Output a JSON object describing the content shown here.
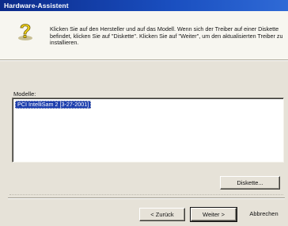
{
  "window": {
    "title": "Hardware-Assistent"
  },
  "header": {
    "icon": "question-mark-icon",
    "instructions": "Klicken Sie auf den Hersteller und auf das Modell. Wenn sich der Treiber auf einer Diskette befindet, klicken Sie auf \"Diskette\". Klicken Sie auf \"Weiter\", um den aktualisierten Treiber zu installieren."
  },
  "models": {
    "label": "Modelle:",
    "items": [
      {
        "label": "PCI IntelliSam 2 [3-27-2001]",
        "selected": true
      }
    ]
  },
  "buttons": {
    "diskette": "Diskette...",
    "back": "< Zurück",
    "next": "Weiter >",
    "cancel": "Abbrechen"
  },
  "colors": {
    "titlebar": "#0b2a8a",
    "selection": "#1d3fae",
    "dialog_bg": "#e6e2d8",
    "header_bg": "#f7f6f0"
  }
}
